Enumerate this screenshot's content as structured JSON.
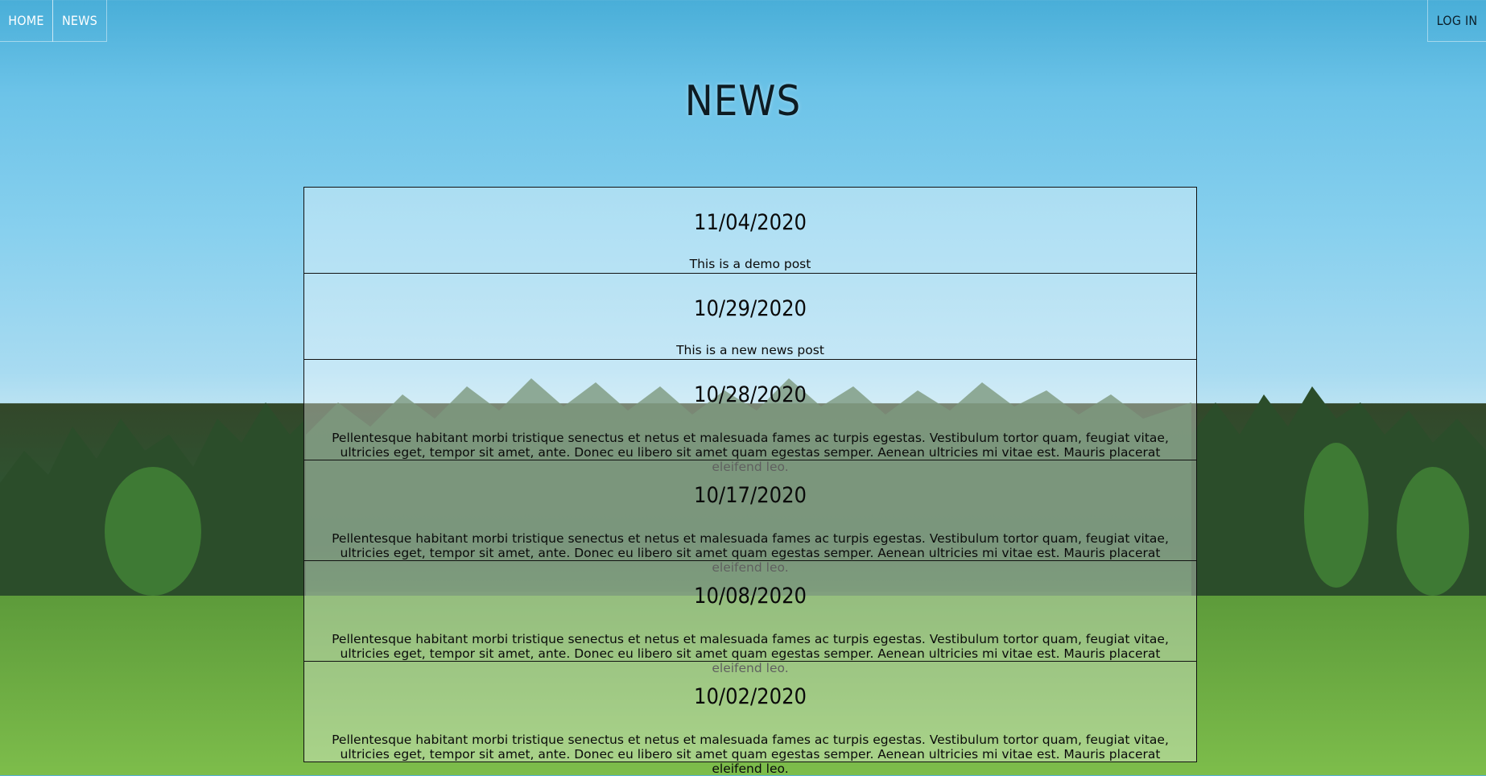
{
  "nav": {
    "home_label": "HOME",
    "news_label": "NEWS",
    "login_label": "LOG IN"
  },
  "page": {
    "title": "NEWS"
  },
  "posts": [
    {
      "date": "11/04/2020",
      "body": "This is a demo post"
    },
    {
      "date": "10/29/2020",
      "body": "This is a new news post"
    },
    {
      "date": "10/28/2020",
      "body": "Pellentesque habitant morbi tristique senectus et netus et malesuada fames ac turpis egestas. Vestibulum tortor quam, feugiat vitae, ultricies eget, tempor sit amet, ante. Donec eu libero sit amet quam egestas semper. Aenean ultricies mi vitae est. Mauris placerat eleifend leo."
    },
    {
      "date": "10/17/2020",
      "body": "Pellentesque habitant morbi tristique senectus et netus et malesuada fames ac turpis egestas. Vestibulum tortor quam, feugiat vitae, ultricies eget, tempor sit amet, ante. Donec eu libero sit amet quam egestas semper. Aenean ultricies mi vitae est. Mauris placerat eleifend leo."
    },
    {
      "date": "10/08/2020",
      "body": "Pellentesque habitant morbi tristique senectus et netus et malesuada fames ac turpis egestas. Vestibulum tortor quam, feugiat vitae, ultricies eget, tempor sit amet, ante. Donec eu libero sit amet quam egestas semper. Aenean ultricies mi vitae est. Mauris placerat eleifend leo."
    },
    {
      "date": "10/02/2020",
      "body": "Pellentesque habitant morbi tristique senectus et netus et malesuada fames ac turpis egestas. Vestibulum tortor quam, feugiat vitae, ultricies eget, tempor sit amet, ante. Donec eu libero sit amet quam egestas semper. Aenean ultricies mi vitae est. Mauris placerat eleifend leo."
    }
  ],
  "colors": {
    "sky": "#6cc3e8",
    "forest": "#2f5230",
    "grass": "#6fb043",
    "text": "#0a0a0a"
  }
}
